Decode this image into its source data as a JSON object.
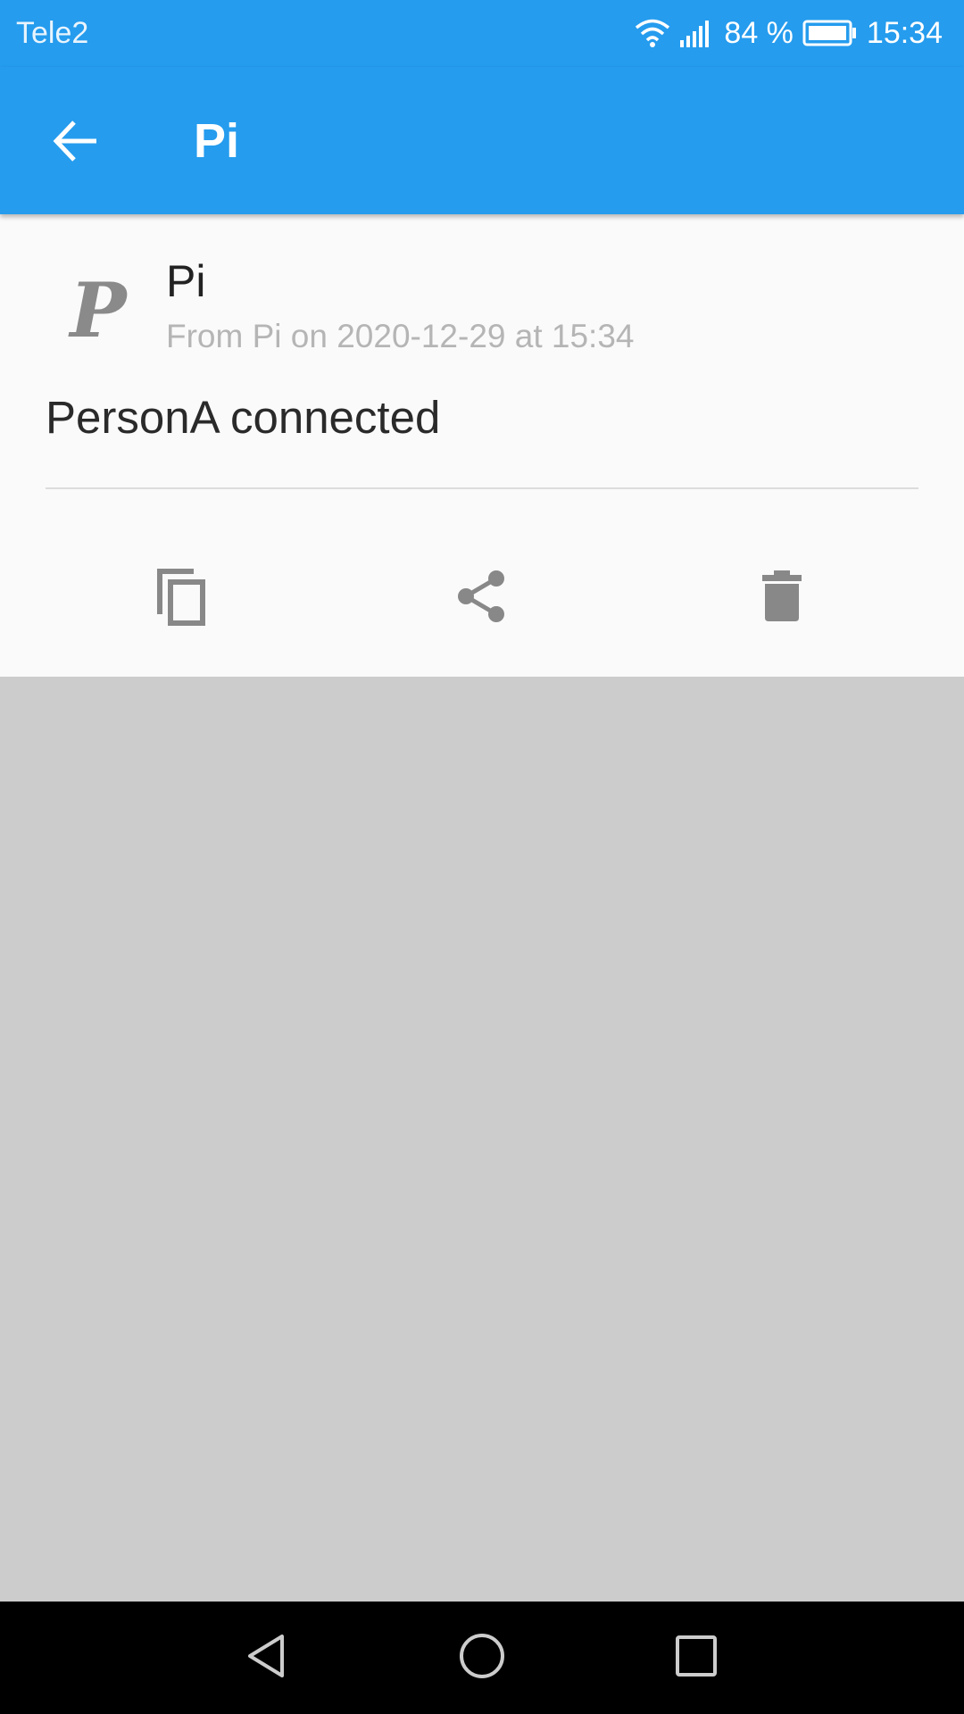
{
  "status_bar": {
    "carrier": "Tele2",
    "battery": "84 %",
    "time": "15:34",
    "icons": [
      "wifi-icon",
      "signal-icon",
      "battery-icon"
    ]
  },
  "app_bar": {
    "title": "Pi",
    "back_icon": "arrow-back-icon",
    "background": "#259cee"
  },
  "message": {
    "sender": "Pi",
    "meta": "From Pi on 2020-12-29 at 15:34",
    "body": "PersonA connected",
    "logo_letter": "P"
  },
  "actions": [
    {
      "name": "copy",
      "icon": "copy-icon"
    },
    {
      "name": "share",
      "icon": "share-icon"
    },
    {
      "name": "delete",
      "icon": "trash-icon"
    }
  ],
  "nav_bar": {
    "icons": [
      "nav-back-icon",
      "nav-home-icon",
      "nav-recents-icon"
    ]
  }
}
